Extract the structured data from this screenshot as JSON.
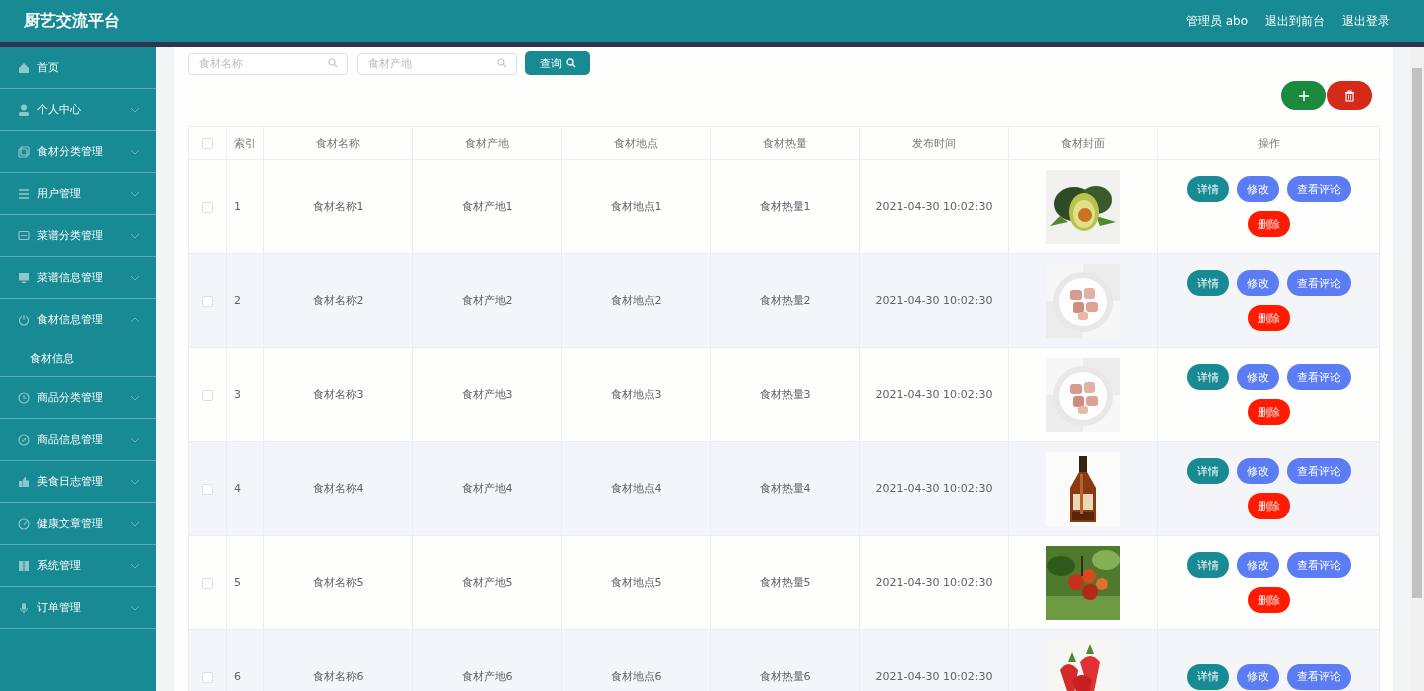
{
  "header": {
    "title": "厨艺交流平台",
    "links": [
      "管理员 abo",
      "退出到前台",
      "退出登录"
    ]
  },
  "sidebar": {
    "items": [
      {
        "label": "首页"
      },
      {
        "label": "个人中心",
        "expanded": false
      },
      {
        "label": "食材分类管理",
        "expanded": false
      },
      {
        "label": "用户管理",
        "expanded": false
      },
      {
        "label": "菜谱分类管理",
        "expanded": false
      },
      {
        "label": "菜谱信息管理",
        "expanded": false
      },
      {
        "label": "食材信息管理",
        "expanded": true,
        "children": [
          {
            "label": "食材信息"
          }
        ]
      },
      {
        "label": "商品分类管理",
        "expanded": false
      },
      {
        "label": "商品信息管理",
        "expanded": false
      },
      {
        "label": "美食日志管理",
        "expanded": false
      },
      {
        "label": "健康文章管理",
        "expanded": false
      },
      {
        "label": "系统管理",
        "expanded": false
      },
      {
        "label": "订单管理",
        "expanded": false
      }
    ]
  },
  "search": {
    "fields": [
      {
        "placeholder": "食材名称"
      },
      {
        "placeholder": "食材产地"
      }
    ],
    "button": "查询"
  },
  "toolbar": [
    {
      "kind": "add",
      "color": "#1b8a3c"
    },
    {
      "kind": "delete",
      "color": "#d42a1a"
    }
  ],
  "table": {
    "select_all": {
      "checked": false
    },
    "columns": [
      "索引",
      "食材名称",
      "食材产地",
      "食材地点",
      "食材热量",
      "发布时间",
      "食材封面",
      "操作"
    ],
    "rows": [
      {
        "checked": false,
        "cells": [
          "1",
          "食材名称1",
          "食材产地1",
          "食材地点1",
          "食材热量1",
          "2021-04-30 10:02:30"
        ],
        "cover": {
          "kind": "picture"
        },
        "actions": [
          {
            "label": "详情",
            "color": "#178a94"
          },
          {
            "label": "修改",
            "color": "#5b7cf2"
          },
          {
            "label": "查看评论",
            "color": "#5b7cf2"
          },
          {
            "label": "删除",
            "color": "#ff1a00"
          }
        ]
      },
      {
        "checked": false,
        "cells": [
          "2",
          "食材名称2",
          "食材产地2",
          "食材地点2",
          "食材热量2",
          "2021-04-30 10:02:30"
        ],
        "cover": {
          "kind": "picture"
        },
        "actions": [
          {
            "label": "详情",
            "color": "#178a94"
          },
          {
            "label": "修改",
            "color": "#5b7cf2"
          },
          {
            "label": "查看评论",
            "color": "#5b7cf2"
          },
          {
            "label": "删除",
            "color": "#ff1a00"
          }
        ]
      },
      {
        "checked": false,
        "cells": [
          "3",
          "食材名称3",
          "食材产地3",
          "食材地点3",
          "食材热量3",
          "2021-04-30 10:02:30"
        ],
        "cover": {
          "kind": "picture"
        },
        "actions": [
          {
            "label": "详情",
            "color": "#178a94"
          },
          {
            "label": "修改",
            "color": "#5b7cf2"
          },
          {
            "label": "查看评论",
            "color": "#5b7cf2"
          },
          {
            "label": "删除",
            "color": "#ff1a00"
          }
        ]
      },
      {
        "checked": false,
        "cells": [
          "4",
          "食材名称4",
          "食材产地4",
          "食材地点4",
          "食材热量4",
          "2021-04-30 10:02:30"
        ],
        "cover": {
          "kind": "picture"
        },
        "actions": [
          {
            "label": "详情",
            "color": "#178a94"
          },
          {
            "label": "修改",
            "color": "#5b7cf2"
          },
          {
            "label": "查看评论",
            "color": "#5b7cf2"
          },
          {
            "label": "删除",
            "color": "#ff1a00"
          }
        ]
      },
      {
        "checked": false,
        "cells": [
          "5",
          "食材名称5",
          "食材产地5",
          "食材地点5",
          "食材热量5",
          "2021-04-30 10:02:30"
        ],
        "cover": {
          "kind": "picture"
        },
        "actions": [
          {
            "label": "详情",
            "color": "#178a94"
          },
          {
            "label": "修改",
            "color": "#5b7cf2"
          },
          {
            "label": "查看评论",
            "color": "#5b7cf2"
          },
          {
            "label": "删除",
            "color": "#ff1a00"
          }
        ]
      },
      {
        "checked": false,
        "cells": [
          "6",
          "食材名称6",
          "食材产地6",
          "食材地点6",
          "食材热量6",
          "2021-04-30 10:02:30"
        ],
        "cover": {
          "kind": "picture"
        },
        "actions": [
          {
            "label": "详情",
            "color": "#178a94"
          },
          {
            "label": "修改",
            "color": "#5b7cf2"
          },
          {
            "label": "查看评论",
            "color": "#5b7cf2"
          }
        ]
      }
    ]
  }
}
